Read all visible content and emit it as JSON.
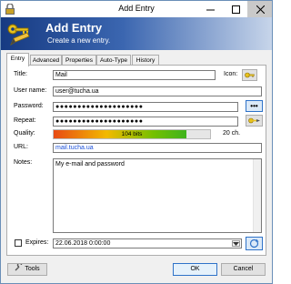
{
  "window": {
    "title": "Add Entry"
  },
  "banner": {
    "title": "Add Entry",
    "subtitle": "Create a new entry."
  },
  "tabs": [
    "Entry",
    "Advanced",
    "Properties",
    "Auto-Type",
    "History"
  ],
  "form": {
    "title_label": "Title:",
    "title_value": "Mail",
    "icon_label": "Icon:",
    "username_label": "User name:",
    "username_value": "user@tucha.ua",
    "password_label": "Password:",
    "password_value": "●●●●●●●●●●●●●●●●●●●●",
    "repeat_label": "Repeat:",
    "repeat_value": "●●●●●●●●●●●●●●●●●●●●",
    "quality_label": "Quality:",
    "quality_text": "104 bits",
    "quality_fraction": 0.85,
    "quality_chars": "20 ch.",
    "url_label": "URL:",
    "url_value": "mail.tucha.ua",
    "notes_label": "Notes:",
    "notes_value": "My e-mail and password",
    "expires_label": "Expires:",
    "expires_value": "22.06.2018   0:00:00"
  },
  "buttons": {
    "tools": "Tools",
    "ok": "OK",
    "cancel": "Cancel",
    "show_password": "•••"
  },
  "colors": {
    "banner_dark": "#163a82",
    "url": "#1a4fd8",
    "accent": "#2f72c8"
  }
}
